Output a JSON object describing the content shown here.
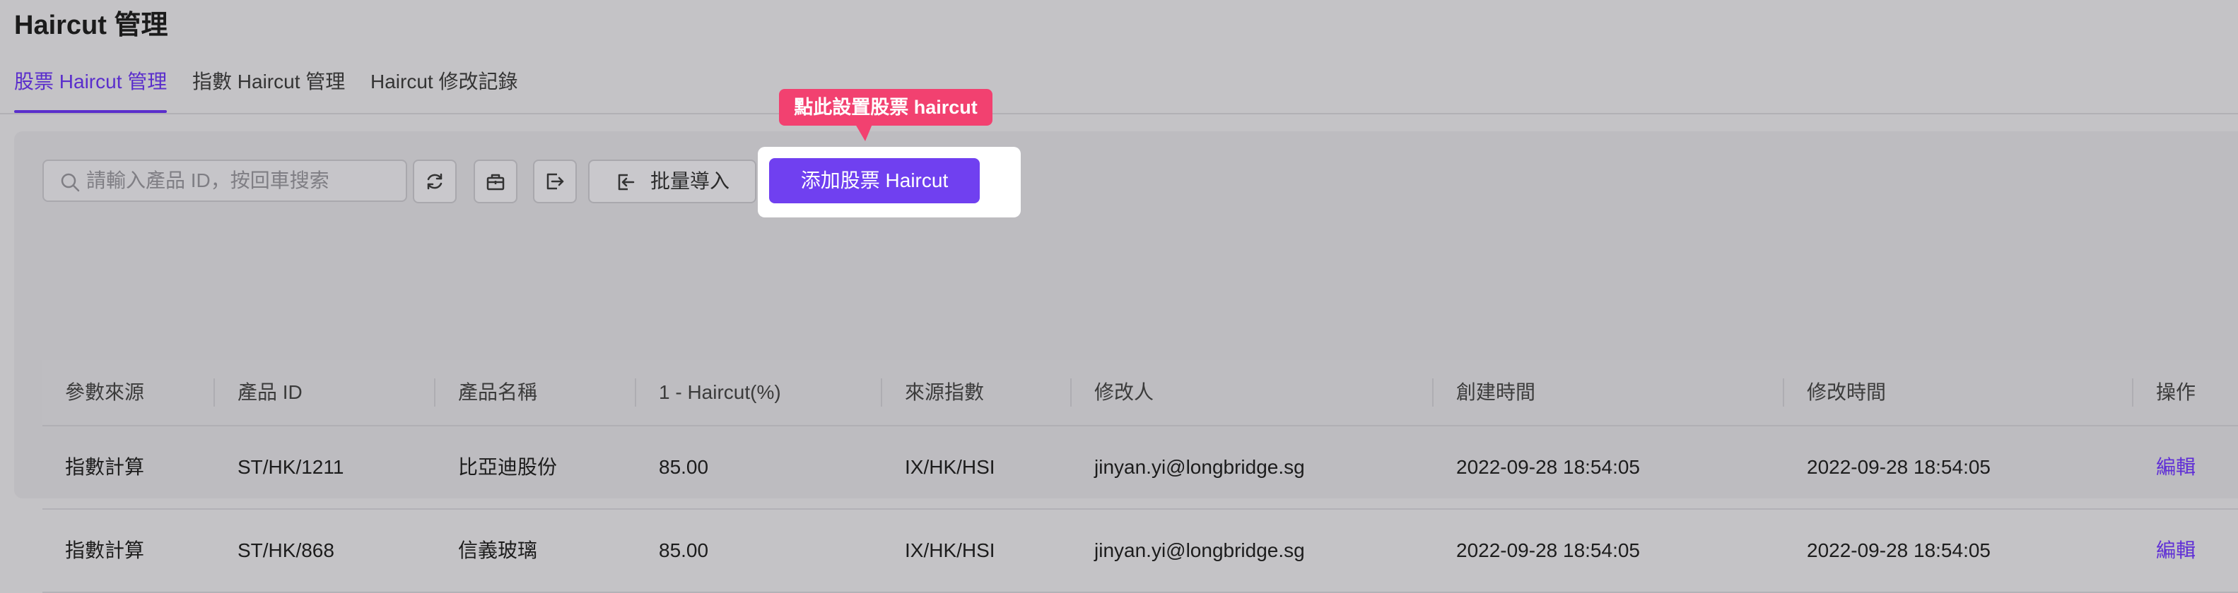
{
  "page": {
    "title": "Haircut 管理"
  },
  "tabs": [
    {
      "label": "股票 Haircut 管理",
      "active": true
    },
    {
      "label": "指數 Haircut 管理",
      "active": false
    },
    {
      "label": "Haircut 修改記錄",
      "active": false
    }
  ],
  "toolbar": {
    "search_placeholder": "請輸入產品 ID，按回車搜索",
    "search_icon": "search-icon",
    "buttons": [
      {
        "icon": "refresh-icon"
      },
      {
        "icon": "basket-icon"
      },
      {
        "icon": "export-icon"
      }
    ],
    "import_label": "批量導入",
    "import_icon": "import-icon",
    "add_label": "添加股票 Haircut",
    "add_color": "#7040f0"
  },
  "tooltip": {
    "text": "點此設置股票 haircut",
    "color": "#f24170"
  },
  "table": {
    "columns": [
      "參數來源",
      "產品 ID",
      "產品名稱",
      "1 - Haircut(%)",
      "來源指數",
      "修改人",
      "創建時間",
      "修改時間",
      "操作"
    ],
    "rows": [
      [
        "指數計算",
        "ST/HK/1211",
        "比亞迪股份",
        "85.00",
        "IX/HK/HSI",
        "jinyan.yi@longbridge.sg",
        "2022-09-28 18:54:05",
        "2022-09-28 18:54:05",
        "編輯"
      ],
      [
        "指數計算",
        "ST/HK/868",
        "信義玻璃",
        "85.00",
        "IX/HK/HSI",
        "jinyan.yi@longbridge.sg",
        "2022-09-28 18:54:05",
        "2022-09-28 18:54:05",
        "編輯"
      ]
    ]
  },
  "accent_color": "#5a2ecc"
}
